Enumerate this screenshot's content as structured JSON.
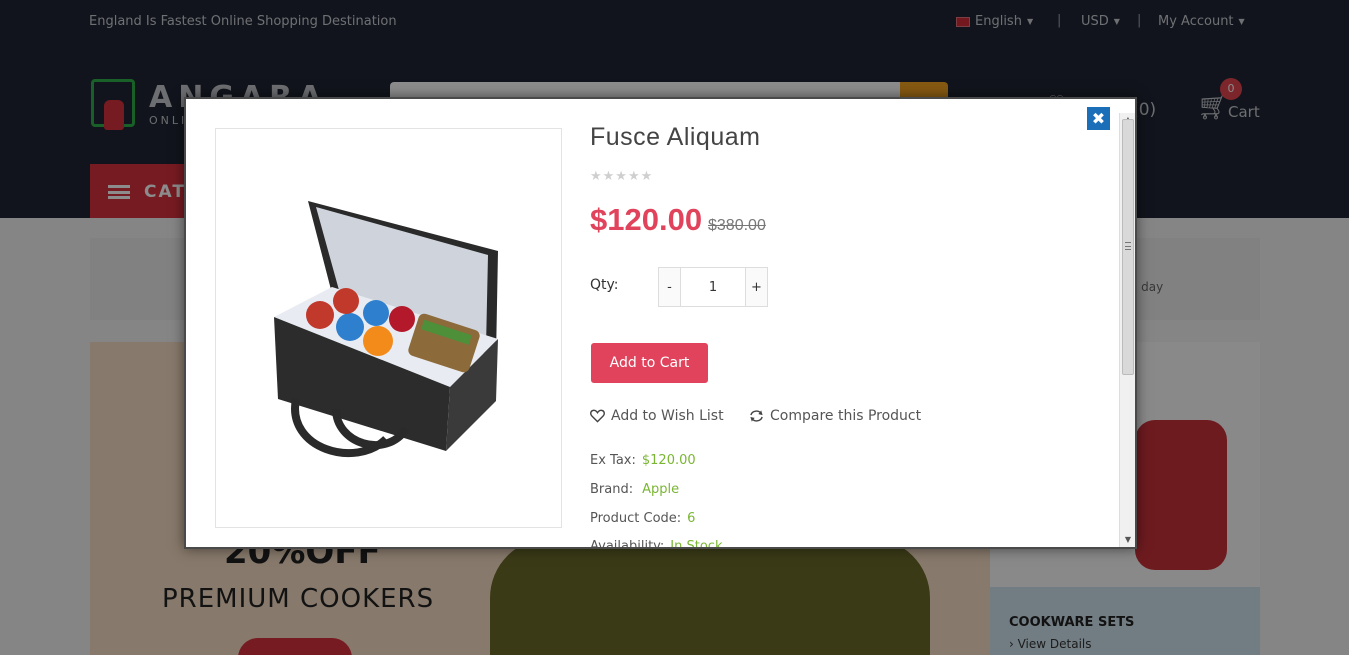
{
  "topbar": {
    "tagline": "England Is Fastest Online Shopping Destination",
    "language": "English",
    "currency": "USD",
    "account": "My Account",
    "separator": "|"
  },
  "header": {
    "logo_title": "ANGARA",
    "logo_sub": "ONLINE",
    "wishlist_count": "t (0)",
    "cart_count": "0",
    "cart_label": "Cart",
    "category_label": "CAT"
  },
  "background": {
    "info_text": "a day",
    "banner_off": "20%OFF",
    "banner_title": "PREMIUM COOKERS",
    "cookware_title": "COOKWARE SETS",
    "cookware_link": "› View Details"
  },
  "modal": {
    "close_glyph": "✖",
    "product_title": "Fusce Aliquam",
    "stars": "★★★★★",
    "rating": 0,
    "price": "$120.00",
    "old_price": "$380.00",
    "qty_label": "Qty:",
    "qty_value": "1",
    "qty_minus": "-",
    "qty_plus": "+",
    "add_to_cart": "Add to Cart",
    "wishlist_label": "Add to Wish List",
    "compare_label": "Compare this Product",
    "ex_tax_label": "Ex Tax:",
    "ex_tax_value": "$120.00",
    "brand_label": "Brand:",
    "brand_value": "Apple",
    "code_label": "Product Code:",
    "code_value": "6",
    "availability_label": "Availability:",
    "availability_value": "In Stock"
  },
  "colors": {
    "accent": "#e0435b",
    "header_bg": "#1f2633",
    "link_green": "#7ab633",
    "close_blue": "#1b6fb8"
  }
}
